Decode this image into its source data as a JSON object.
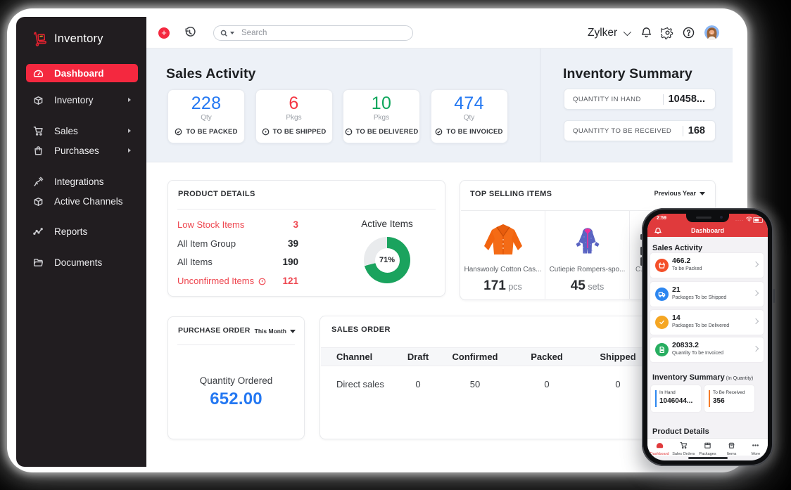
{
  "app_title": "Inventory",
  "sidebar": {
    "logo_label": "Inventory",
    "items": [
      {
        "label": "Dashboard",
        "active": true
      },
      {
        "label": "Inventory",
        "arrow": true
      },
      {
        "label": "Sales",
        "arrow": true
      },
      {
        "label": "Purchases",
        "arrow": true
      },
      {
        "label": "Integrations"
      },
      {
        "label": "Active Channels"
      },
      {
        "label": "Reports"
      },
      {
        "label": "Documents"
      }
    ]
  },
  "topbar": {
    "search_placeholder": "Search",
    "org_name": "Zylker"
  },
  "sales_activity": {
    "title": "Sales Activity",
    "cards": [
      {
        "value": "228",
        "unit": "Qty",
        "label": "TO BE PACKED",
        "color": "#2478f2",
        "icon": "circle-check"
      },
      {
        "value": "6",
        "unit": "Pkgs",
        "label": "TO BE SHIPPED",
        "color": "#f43744",
        "icon": "circle-dot"
      },
      {
        "value": "10",
        "unit": "Pkgs",
        "label": "TO BE DELIVERED",
        "color": "#0da65b",
        "icon": "circle-ellipsis"
      },
      {
        "value": "474",
        "unit": "Qty",
        "label": "TO BE INVOICED",
        "color": "#2478f2",
        "icon": "circle-check"
      }
    ]
  },
  "inventory_summary": {
    "title": "Inventory Summary",
    "rows": [
      {
        "label": "QUANTITY IN HAND",
        "value": "10458..."
      },
      {
        "label": "QUANTITY TO BE RECEIVED",
        "value": "168"
      }
    ]
  },
  "product_details": {
    "title": "PRODUCT DETAILS",
    "rows": [
      {
        "label": "Low Stock Items",
        "value": "3",
        "alert": true
      },
      {
        "label": "All Item Group",
        "value": "39"
      },
      {
        "label": "All Items",
        "value": "190"
      },
      {
        "label": "Unconfirmed Items",
        "value": "121",
        "alert": true
      }
    ],
    "alert_color": "#ee4750",
    "donut": {
      "label": "Active Items",
      "percent": 71,
      "percent_text": "71%",
      "color": "#1aa35e",
      "track_color": "#e9ebed"
    }
  },
  "top_selling": {
    "title": "TOP SELLING ITEMS",
    "period": "Previous Year",
    "items": [
      {
        "name": "Hanswooly Cotton Cas...",
        "qty": "171",
        "unit": " pcs"
      },
      {
        "name": "Cutiepie Rompers-spo...",
        "qty": "45",
        "unit": " sets"
      },
      {
        "name": "C...",
        "qty": "",
        "unit": ""
      }
    ]
  },
  "purchase_order": {
    "title": "PURCHASE ORDER",
    "period": "This Month",
    "label": "Quantity Ordered",
    "value": "652.00",
    "value_color": "#2478f2"
  },
  "sales_order": {
    "title": "SALES ORDER",
    "columns": [
      "Channel",
      "Draft",
      "Confirmed",
      "Packed",
      "Shipped"
    ],
    "rows": [
      {
        "channel": "Direct sales",
        "draft": "0",
        "confirmed": "50",
        "packed": "0",
        "shipped": "0"
      }
    ]
  },
  "phone": {
    "time": "2:59",
    "nav_title": "Dashboard",
    "header_color": "#e03a3c",
    "sales_activity_title": "Sales Activity",
    "cards": [
      {
        "value": "466.2",
        "label": "To be Packed",
        "color": "#f4502a",
        "icon": "basket"
      },
      {
        "value": "21",
        "label": "Packages To be Shipped",
        "color": "#2d87f0",
        "icon": "truck"
      },
      {
        "value": "14",
        "label": "Packages To be Delivered",
        "color": "#f5a623",
        "icon": "check"
      },
      {
        "value": "20833.2",
        "label": "Quantity To be Invoiced",
        "color": "#27ae60",
        "icon": "invoice"
      }
    ],
    "inventory_summary_title": "Inventory Summary",
    "inventory_summary_suffix": " (In Quantity)",
    "summary_boxes": [
      {
        "label": "In Hand",
        "value": "1046044...",
        "accent": "#2d87f0"
      },
      {
        "label": "To Be Received",
        "value": "356",
        "accent": "#f57c2a"
      }
    ],
    "product_details_title": "Product Details",
    "tabs": [
      {
        "label": "Dashboard",
        "active": true
      },
      {
        "label": "Sales Orders"
      },
      {
        "label": "Packages"
      },
      {
        "label": "Items"
      },
      {
        "label": "More"
      }
    ]
  }
}
